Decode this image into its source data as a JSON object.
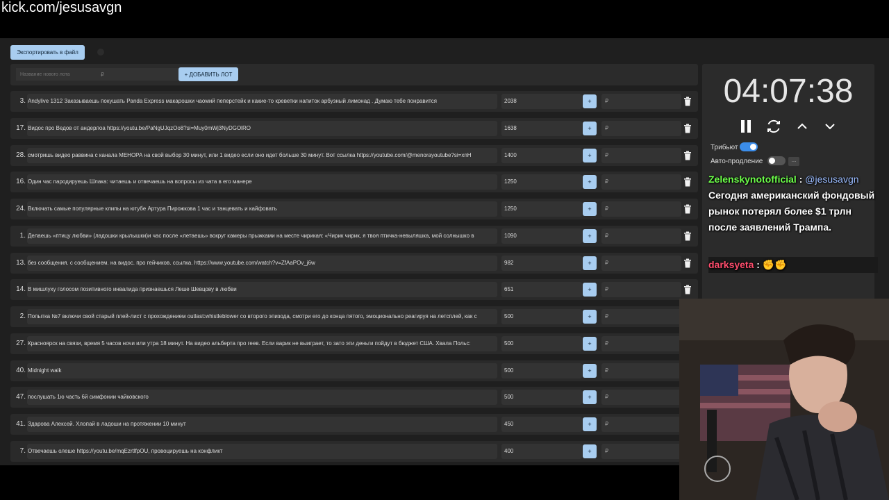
{
  "url": "kick.com/jesusavgn",
  "toolbar": {
    "export_label": "Экспортировать в файл"
  },
  "new_lot": {
    "name_placeholder": "Название нового лота",
    "price_placeholder": "₽",
    "add_label": "+ ДОБАВИТЬ ЛОТ"
  },
  "lots": [
    {
      "num": "3.",
      "title": "Andylive 1312 Заказываешь покушать Panda Express макарошки чаомий пеперстейк и какие-то креветки напиток арбузный лимонад . Думаю тебе понравится",
      "amount": "2038",
      "plus": "+",
      "addprice": "₽"
    },
    {
      "num": "17.",
      "title": "Видос про Ведов от андерлоа https://youtu.be/PaNgUJqzOo8?si=Muy0mWj3NyDGOlRO",
      "amount": "1638",
      "plus": "+",
      "addprice": "₽"
    },
    {
      "num": "28.",
      "title": "смотришь видео раввина с канала МЕНОРА на свой выбор 30 минут, или 1 видео если оно идет больше 30 минут. Вот ссылка https://youtube.com/@menorayoutube?si=xnH",
      "amount": "1400",
      "plus": "+",
      "addprice": "₽"
    },
    {
      "num": "16.",
      "title": "Один час пародируешь Шлака: читаешь и отвечаешь на вопросы из чата в его манере",
      "amount": "1250",
      "plus": "+",
      "addprice": "₽"
    },
    {
      "num": "24.",
      "title": "Включать самые популярные клипы на ютубе Артура Пирожкова 1 час и танцевать и кайфовать",
      "amount": "1250",
      "plus": "+",
      "addprice": "₽"
    },
    {
      "num": "1.",
      "title": "Делаешь «птицу любви» (ладошки крылышки)и час после «летаешь» вокруг камеры прыжками на месте чирикая: «Чирик чирик, я твоя птичка-невыляшка, мой солнышко в",
      "amount": "1090",
      "plus": "+",
      "addprice": "₽"
    },
    {
      "num": "13.",
      "title": "без сообщения. с сообщением. на видос. про гейчиков. ссылка. https://www.youtube.com/watch?v=ZfAaPOv_j6w",
      "amount": "982",
      "plus": "+",
      "addprice": "₽"
    },
    {
      "num": "14.",
      "title": "В мишлуху голосом позитивного инвалида признаешься Леше Шевцову в любви",
      "amount": "651",
      "plus": "+",
      "addprice": "₽"
    },
    {
      "num": "2.",
      "title": "Попытка №7 включи свой старый плей-лист с прохождением outlast:whistleblower со второго эпизода, смотри его до конца пятого, эмоционально реагируя на летсплей, как с",
      "amount": "500",
      "plus": "+",
      "addprice": "₽"
    },
    {
      "num": "27.",
      "title": "Красноярск на связи, время 5 часов ночи или утра 18 минут. На видео альберта про геев. Если варик не выиграет, то зато эти деньги пойдут в бюджет США. Хвала Польс:",
      "amount": "500",
      "plus": "+",
      "addprice": "₽"
    },
    {
      "num": "40.",
      "title": "Midnight walk",
      "amount": "500",
      "plus": "+",
      "addprice": "₽"
    },
    {
      "num": "47.",
      "title": "послушать 1ю часть 6й симфонии чайковского",
      "amount": "500",
      "plus": "+",
      "addprice": "₽"
    },
    {
      "num": "41.",
      "title": "Здарова Алексей. Хлопай в ладоши на протяжении 10 минут",
      "amount": "450",
      "plus": "+",
      "addprice": "₽"
    },
    {
      "num": "7.",
      "title": "Отвечаешь олеше https://youtu.be/mqEzrtlfpOU, провоцируешь на конфликт",
      "amount": "400",
      "plus": "+",
      "addprice": "₽"
    }
  ],
  "timer": {
    "value": "04:07:38",
    "tribute_label": "Трибьют",
    "autoextend_label": "Авто-продление",
    "more_label": "..."
  },
  "chat": [
    {
      "user": "Zelenskynotofficial",
      "sep": " : ",
      "mention": "@jesusavgn",
      "text": "Сегодня американский фондовый рынок потерял более $1 трлн после заявлений Трампа.",
      "user_color": "#6dff4a",
      "mention_color": "#9bbcff"
    },
    {
      "user": "darksyeta",
      "sep": " : ",
      "text": "✊✊",
      "user_color": "#ff4d6d"
    }
  ],
  "colors": {
    "accent": "#a8cdf0",
    "toggle_on": "#3b8dea",
    "panel": "#2a2a2a",
    "input": "#333333"
  }
}
